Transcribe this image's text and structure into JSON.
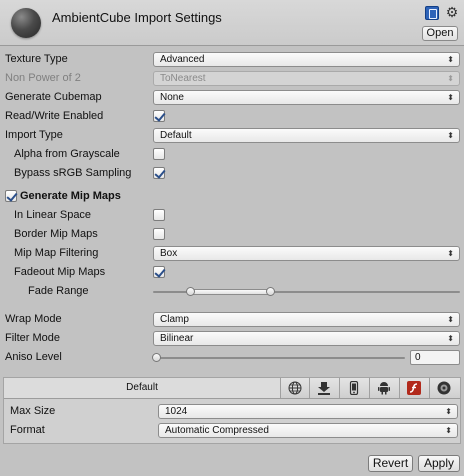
{
  "header": {
    "title": "AmbientCube Import Settings",
    "open_button": "Open",
    "help_icon": "help-book-icon",
    "gear_icon": "gear-icon"
  },
  "settings": {
    "texture_type": {
      "label": "Texture Type",
      "value": "Advanced"
    },
    "non_power_of_2": {
      "label": "Non Power of 2",
      "value": "ToNearest"
    },
    "generate_cubemap": {
      "label": "Generate Cubemap",
      "value": "None"
    },
    "read_write": {
      "label": "Read/Write Enabled",
      "checked": true
    },
    "import_type": {
      "label": "Import Type",
      "value": "Default"
    },
    "alpha_from_grayscale": {
      "label": "Alpha from Grayscale",
      "checked": false
    },
    "bypass_srgb": {
      "label": "Bypass sRGB Sampling",
      "checked": true
    },
    "generate_mip_maps": {
      "label": "Generate Mip Maps",
      "checked": true
    },
    "in_linear_space": {
      "label": "In Linear Space",
      "checked": false
    },
    "border_mip_maps": {
      "label": "Border Mip Maps",
      "checked": false
    },
    "mip_map_filtering": {
      "label": "Mip Map Filtering",
      "value": "Box"
    },
    "fadeout_mip_maps": {
      "label": "Fadeout Mip Maps",
      "checked": true
    },
    "fade_range": {
      "label": "Fade Range",
      "min_fraction": 0.12,
      "max_fraction": 0.38
    },
    "wrap_mode": {
      "label": "Wrap Mode",
      "value": "Clamp"
    },
    "filter_mode": {
      "label": "Filter Mode",
      "value": "Bilinear"
    },
    "aniso_level": {
      "label": "Aniso Level",
      "value": "0"
    }
  },
  "platform": {
    "tabs": [
      {
        "label": "Default",
        "icon": null
      },
      {
        "label": "",
        "icon": "globe-icon"
      },
      {
        "label": "",
        "icon": "download-icon"
      },
      {
        "label": "",
        "icon": "iphone-icon"
      },
      {
        "label": "",
        "icon": "android-icon"
      },
      {
        "label": "",
        "icon": "flash-icon"
      },
      {
        "label": "",
        "icon": "disc-icon"
      }
    ],
    "max_size": {
      "label": "Max Size",
      "value": "1024"
    },
    "format": {
      "label": "Format",
      "value": "Automatic Compressed"
    }
  },
  "footer": {
    "revert_button": "Revert",
    "apply_button": "Apply"
  },
  "colors": {
    "background": "#c2c2c2",
    "check_blue": "#2b4f8a",
    "help_blue": "#2e63b8"
  }
}
